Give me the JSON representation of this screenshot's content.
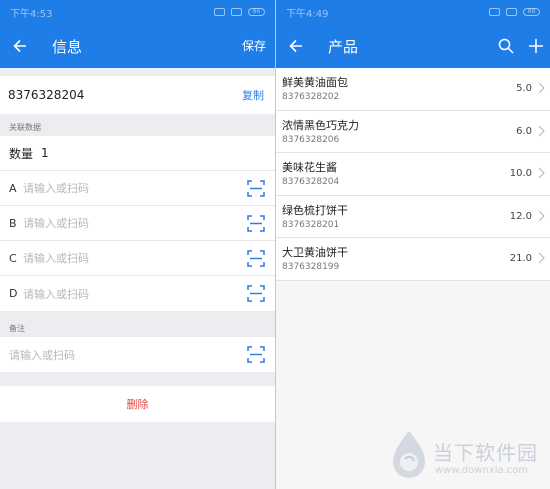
{
  "left": {
    "status": {
      "time": "下午4:53",
      "battery": "86"
    },
    "header": {
      "title": "信息",
      "save_label": "保存"
    },
    "barcode": {
      "value": "8376328204",
      "copy_label": "复制"
    },
    "related_section": {
      "label": "关联数据"
    },
    "quantity": {
      "label": "数量",
      "value": "1"
    },
    "fields": [
      {
        "key": "A",
        "placeholder": "请输入或扫码"
      },
      {
        "key": "B",
        "placeholder": "请输入或扫码"
      },
      {
        "key": "C",
        "placeholder": "请输入或扫码"
      },
      {
        "key": "D",
        "placeholder": "请输入或扫码"
      }
    ],
    "note": {
      "label": "备注",
      "placeholder": "请输入或扫码"
    },
    "delete_label": "删除"
  },
  "right": {
    "status": {
      "time": "下午4:49",
      "battery": "88"
    },
    "header": {
      "title": "产品"
    },
    "products": [
      {
        "name": "鲜美黄油面包",
        "code": "8376328202",
        "value": "5.0"
      },
      {
        "name": "浓情黑色巧克力",
        "code": "8376328206",
        "value": "6.0"
      },
      {
        "name": "美味花生酱",
        "code": "8376328204",
        "value": "10.0"
      },
      {
        "name": "绿色梳打饼干",
        "code": "8376328201",
        "value": "12.0"
      },
      {
        "name": "大卫黄油饼干",
        "code": "8376328199",
        "value": "21.0"
      }
    ]
  },
  "watermark": {
    "brand": "当下软件园",
    "url": "www.downxia.com"
  },
  "colors": {
    "primary": "#1f7de8",
    "danger": "#e84343",
    "link": "#2b7de8"
  }
}
